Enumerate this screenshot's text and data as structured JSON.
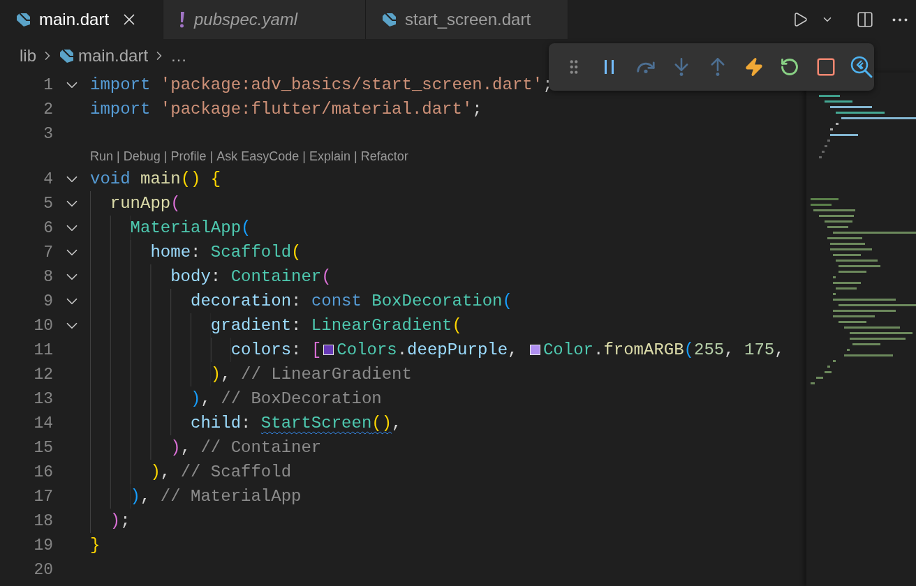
{
  "tabs": [
    {
      "label": "main.dart",
      "kind": "dart",
      "selected": true,
      "preview": false,
      "closable": true
    },
    {
      "label": "pubspec.yaml",
      "kind": "yaml",
      "selected": false,
      "preview": true,
      "closable": false
    },
    {
      "label": "start_screen.dart",
      "kind": "dart",
      "selected": false,
      "preview": false,
      "closable": false
    }
  ],
  "title_actions": [
    {
      "kind": "run"
    },
    {
      "kind": "dropdown"
    },
    {
      "kind": "split"
    },
    {
      "kind": "more"
    }
  ],
  "breadcrumbs": [
    {
      "label": "lib",
      "kind": "folder"
    },
    {
      "label": "main.dart",
      "kind": "dart"
    },
    {
      "label": "…",
      "kind": "symbol"
    }
  ],
  "debug_toolbar": [
    {
      "kind": "grip"
    },
    {
      "kind": "pause"
    },
    {
      "kind": "step-over"
    },
    {
      "kind": "step-into"
    },
    {
      "kind": "step-out"
    },
    {
      "kind": "hot-reload"
    },
    {
      "kind": "restart"
    },
    {
      "kind": "stop"
    },
    {
      "kind": "inspector"
    }
  ],
  "lines": [
    {
      "number": "1",
      "foldable": true,
      "tokens": [
        {
          "kind": "kw",
          "t": "import"
        },
        {
          "kind": "str",
          "t": " 'package:adv_basics/start_screen.dart'"
        },
        {
          "kind": "p",
          "t": ";"
        }
      ]
    },
    {
      "number": "2",
      "foldable": false,
      "tokens": [
        {
          "kind": "kw",
          "t": "import"
        },
        {
          "kind": "str",
          "t": " 'package:flutter/material.dart'"
        },
        {
          "kind": "p",
          "t": ";"
        }
      ]
    },
    {
      "number": "3",
      "foldable": false
    },
    {
      "number": "4",
      "foldable": true,
      "codelens": {
        "items": [
          "Run",
          "Debug",
          "Profile",
          "Ask EasyCode",
          "Explain",
          "Refactor"
        ],
        "separator": "|"
      },
      "tokens": [
        {
          "kind": "kw",
          "t": "void"
        },
        {
          "kind": "fn",
          "t": " main"
        },
        {
          "kind": "b1",
          "t": "()"
        },
        {
          "kind": "b1",
          "t": " {"
        }
      ]
    },
    {
      "number": "5",
      "foldable": true,
      "tokens": [
        {
          "kind": "fn",
          "t": "  runApp"
        },
        {
          "kind": "b2",
          "t": "("
        }
      ]
    },
    {
      "number": "6",
      "foldable": true,
      "tokens": [
        {
          "kind": "type",
          "t": "    MaterialApp"
        },
        {
          "kind": "b3",
          "t": "("
        }
      ]
    },
    {
      "number": "7",
      "foldable": true,
      "tokens": [
        {
          "kind": "prop",
          "t": "      home"
        },
        {
          "kind": "p",
          "t": ": "
        },
        {
          "kind": "type",
          "t": "Scaffold"
        },
        {
          "kind": "b1",
          "t": "("
        }
      ]
    },
    {
      "number": "8",
      "foldable": true,
      "tokens": [
        {
          "kind": "prop",
          "t": "        body"
        },
        {
          "kind": "p",
          "t": ": "
        },
        {
          "kind": "type",
          "t": "Container"
        },
        {
          "kind": "b2",
          "t": "("
        }
      ]
    },
    {
      "number": "9",
      "foldable": true,
      "tokens": [
        {
          "kind": "prop",
          "t": "          decoration"
        },
        {
          "kind": "p",
          "t": ": "
        },
        {
          "kind": "kw",
          "t": "const"
        },
        {
          "kind": "type",
          "t": " BoxDecoration"
        },
        {
          "kind": "b3",
          "t": "("
        }
      ]
    },
    {
      "number": "10",
      "foldable": true,
      "tokens": [
        {
          "kind": "prop",
          "t": "            gradient"
        },
        {
          "kind": "p",
          "t": ": "
        },
        {
          "kind": "type",
          "t": "LinearGradient"
        },
        {
          "kind": "b1",
          "t": "("
        }
      ]
    },
    {
      "number": "11",
      "foldable": false,
      "tokens": [
        {
          "kind": "prop",
          "t": "              colors"
        },
        {
          "kind": "p",
          "t": ": "
        },
        {
          "kind": "b2",
          "t": "["
        },
        {
          "kind": "swatch",
          "color": "#673ab7"
        },
        {
          "kind": "type",
          "t": "Colors"
        },
        {
          "kind": "p",
          "t": "."
        },
        {
          "kind": "prop",
          "t": "deepPurple"
        },
        {
          "kind": "p",
          "t": ", "
        },
        {
          "kind": "swatch",
          "color": "#af8ff0"
        },
        {
          "kind": "type",
          "t": "Color"
        },
        {
          "kind": "p",
          "t": "."
        },
        {
          "kind": "fn",
          "t": "fromARGB"
        },
        {
          "kind": "b3",
          "t": "("
        },
        {
          "kind": "num",
          "t": "255"
        },
        {
          "kind": "p",
          "t": ", "
        },
        {
          "kind": "num",
          "t": "175"
        },
        {
          "kind": "p",
          "t": ","
        }
      ]
    },
    {
      "number": "12",
      "foldable": false,
      "tokens": [
        {
          "kind": "b1",
          "t": "            )"
        },
        {
          "kind": "p",
          "t": ", "
        },
        {
          "kind": "cm",
          "t": "// LinearGradient"
        }
      ]
    },
    {
      "number": "13",
      "foldable": false,
      "tokens": [
        {
          "kind": "b3",
          "t": "          )"
        },
        {
          "kind": "p",
          "t": ", "
        },
        {
          "kind": "cm",
          "t": "// BoxDecoration"
        }
      ]
    },
    {
      "number": "14",
      "foldable": false,
      "tokens": [
        {
          "kind": "prop",
          "t": "          child"
        },
        {
          "kind": "p",
          "t": ": "
        },
        {
          "kind": "type",
          "t": "StartScreen",
          "warning": true
        },
        {
          "kind": "b1",
          "t": "()",
          "warning": true
        },
        {
          "kind": "p",
          "t": ","
        }
      ]
    },
    {
      "number": "15",
      "foldable": false,
      "tokens": [
        {
          "kind": "b2",
          "t": "        )"
        },
        {
          "kind": "p",
          "t": ", "
        },
        {
          "kind": "cm",
          "t": "// Container"
        }
      ]
    },
    {
      "number": "16",
      "foldable": false,
      "tokens": [
        {
          "kind": "b1",
          "t": "      )"
        },
        {
          "kind": "p",
          "t": ", "
        },
        {
          "kind": "cm",
          "t": "// Scaffold"
        }
      ]
    },
    {
      "number": "17",
      "foldable": false,
      "tokens": [
        {
          "kind": "b3",
          "t": "    )"
        },
        {
          "kind": "p",
          "t": ", "
        },
        {
          "kind": "cm",
          "t": "// MaterialApp"
        }
      ]
    },
    {
      "number": "18",
      "foldable": false,
      "tokens": [
        {
          "kind": "b2",
          "t": "  )"
        },
        {
          "kind": "p",
          "t": ";"
        }
      ]
    },
    {
      "number": "19",
      "foldable": false,
      "tokens": [
        {
          "kind": "b1",
          "t": "}"
        }
      ]
    },
    {
      "number": "20",
      "foldable": false
    }
  ]
}
